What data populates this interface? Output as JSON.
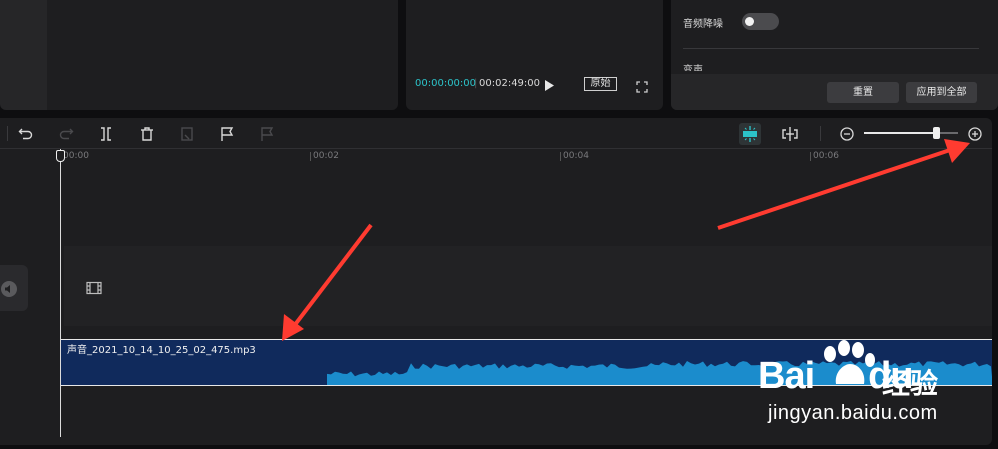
{
  "player": {
    "current_time": "00:00:00:00",
    "total_time": "00:02:49:00",
    "original_label": "原始"
  },
  "properties": {
    "denoise_label": "音频降噪",
    "denoise_on": false,
    "voice_change_label": "变声",
    "reset_label": "重置",
    "apply_all_label": "应用到全部"
  },
  "toolbar": {
    "icons": [
      "undo-icon",
      "redo-icon",
      "split-icon",
      "delete-icon",
      "freeze-frame-icon",
      "marker-icon",
      "marker-disabled-icon",
      "magnet-icon",
      "link-icon",
      "zoom-out-icon",
      "zoom-in-icon"
    ],
    "zoom_level": 0.77
  },
  "ruler": {
    "ticks": [
      "00:00",
      "00:02",
      "00:04",
      "00:06"
    ]
  },
  "audio_clip": {
    "name": "声音_2021_10_14_10_25_02_475.mp3"
  },
  "watermark": {
    "brand": "Bai",
    "brand2": "du",
    "cn": "经验",
    "url": "jingyan.baidu.com"
  },
  "colors": {
    "accent": "#2cc3c9",
    "clip_bg": "#102a5c",
    "waveform": "#1b8ccc",
    "arrow": "#ff3b30"
  }
}
